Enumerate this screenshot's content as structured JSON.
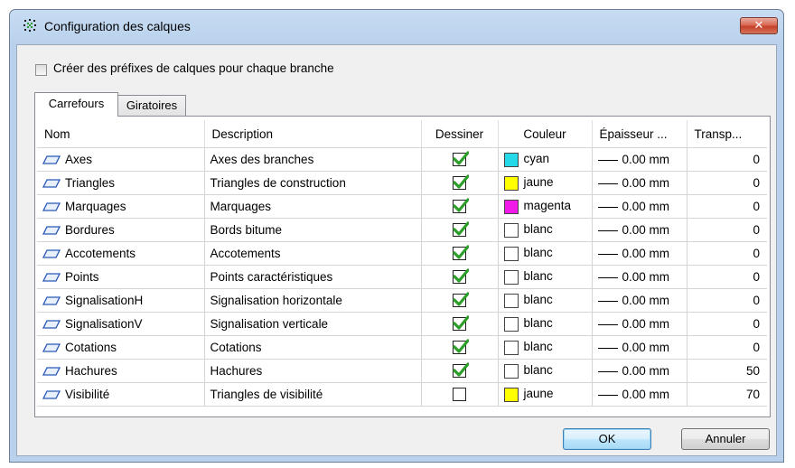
{
  "window": {
    "title": "Configuration des calques",
    "close_label": "✕"
  },
  "options": {
    "prefix_label": "Créer des préfixes de calques pour chaque branche",
    "prefix_checked": false
  },
  "tabs": [
    {
      "label": "Carrefours",
      "active": true
    },
    {
      "label": "Giratoires",
      "active": false
    }
  ],
  "columns": {
    "name": "Nom",
    "description": "Description",
    "draw": "Dessiner",
    "color": "Couleur",
    "thickness": "Épaisseur ...",
    "transparency": "Transp..."
  },
  "colors": {
    "cyan": "#25d9e8",
    "jaune": "#ffff00",
    "magenta": "#f019e8",
    "blanc": "#ffffff",
    "check": "#2e9e2a"
  },
  "layers": [
    {
      "name": "Axes",
      "description": "Axes des branches",
      "draw": true,
      "color": "cyan",
      "thickness": "0.00 mm",
      "transparency": "0"
    },
    {
      "name": "Triangles",
      "description": "Triangles de construction",
      "draw": true,
      "color": "jaune",
      "thickness": "0.00 mm",
      "transparency": "0"
    },
    {
      "name": "Marquages",
      "description": "Marquages",
      "draw": true,
      "color": "magenta",
      "thickness": "0.00 mm",
      "transparency": "0"
    },
    {
      "name": "Bordures",
      "description": "Bords bitume",
      "draw": true,
      "color": "blanc",
      "thickness": "0.00 mm",
      "transparency": "0"
    },
    {
      "name": "Accotements",
      "description": "Accotements",
      "draw": true,
      "color": "blanc",
      "thickness": "0.00 mm",
      "transparency": "0"
    },
    {
      "name": "Points",
      "description": "Points caractéristiques",
      "draw": true,
      "color": "blanc",
      "thickness": "0.00 mm",
      "transparency": "0"
    },
    {
      "name": "SignalisationH",
      "description": "Signalisation horizontale",
      "draw": true,
      "color": "blanc",
      "thickness": "0.00 mm",
      "transparency": "0"
    },
    {
      "name": "SignalisationV",
      "description": "Signalisation verticale",
      "draw": true,
      "color": "blanc",
      "thickness": "0.00 mm",
      "transparency": "0"
    },
    {
      "name": "Cotations",
      "description": "Cotations",
      "draw": true,
      "color": "blanc",
      "thickness": "0.00 mm",
      "transparency": "0"
    },
    {
      "name": "Hachures",
      "description": "Hachures",
      "draw": true,
      "color": "blanc",
      "thickness": "0.00 mm",
      "transparency": "50"
    },
    {
      "name": "Visibilité",
      "description": "Triangles de visibilité",
      "draw": false,
      "color": "jaune",
      "thickness": "0.00 mm",
      "transparency": "70"
    }
  ],
  "buttons": {
    "ok": "OK",
    "cancel": "Annuler"
  }
}
